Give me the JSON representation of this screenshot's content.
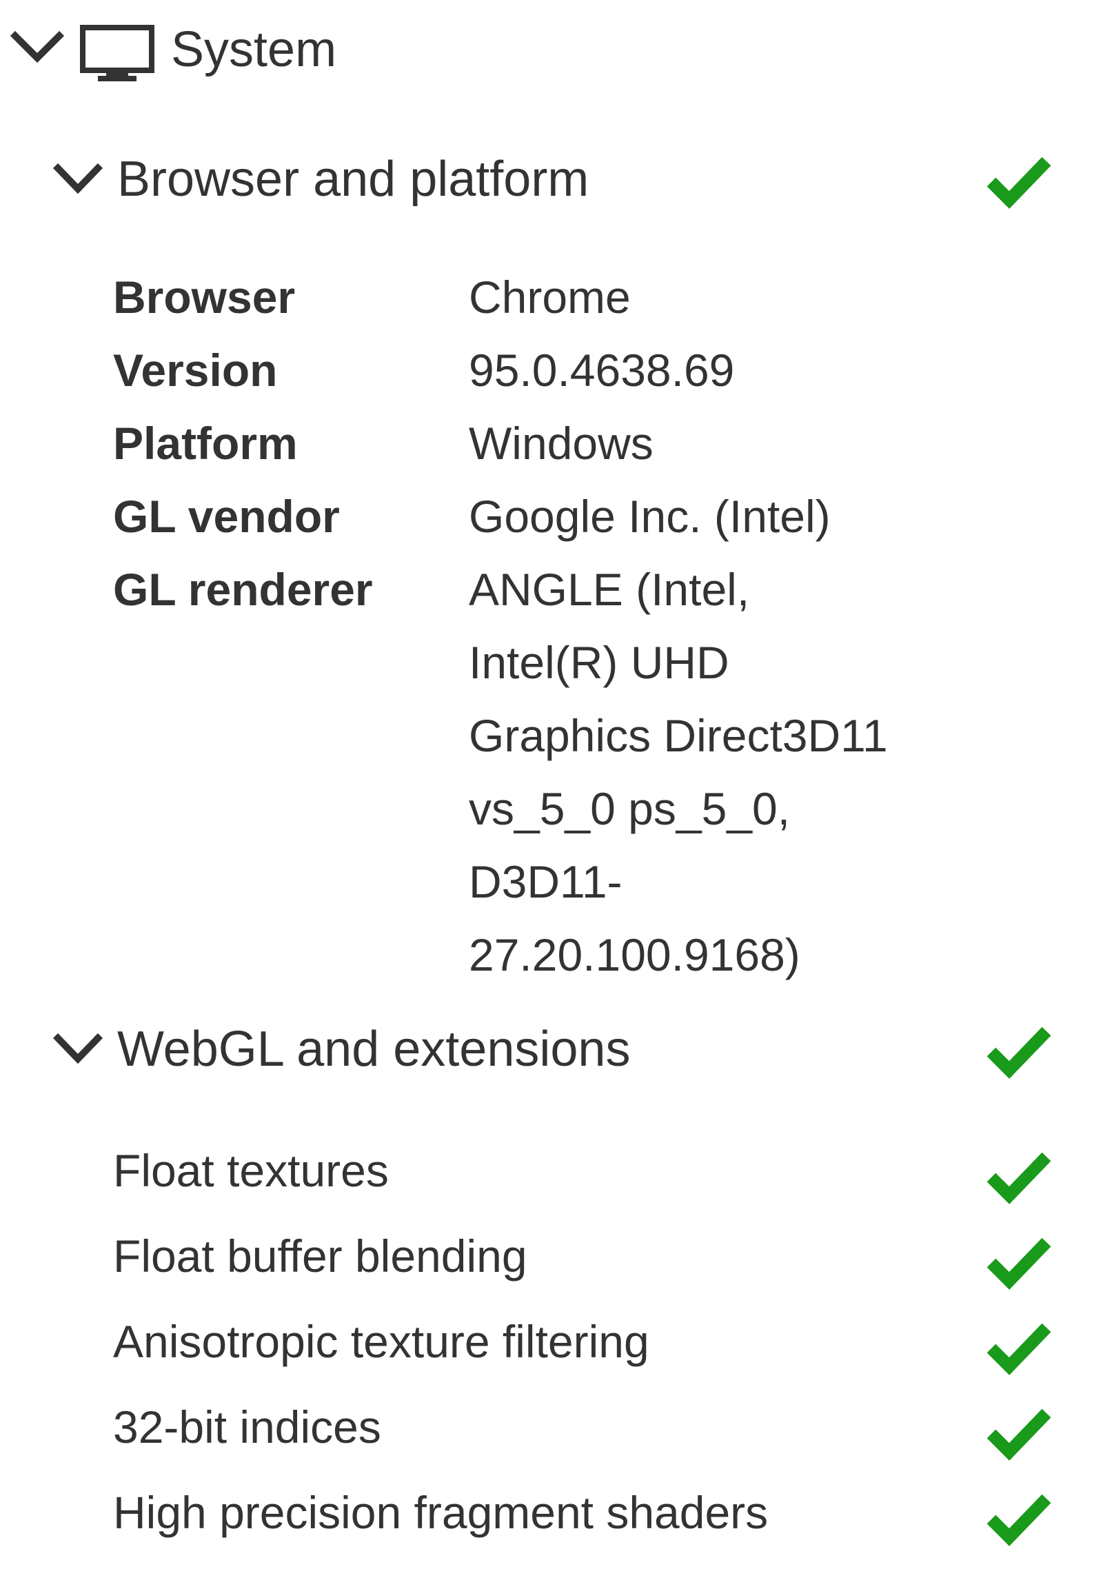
{
  "system": {
    "title": "System",
    "icon": "monitor-icon"
  },
  "browser_platform": {
    "title": "Browser and platform",
    "status": "ok",
    "rows": [
      {
        "key": "Browser",
        "value": "Chrome"
      },
      {
        "key": "Version",
        "value": "95.0.4638.69"
      },
      {
        "key": "Platform",
        "value": "Windows"
      },
      {
        "key": "GL vendor",
        "value": "Google Inc. (Intel)"
      },
      {
        "key": "GL renderer",
        "value_lines": [
          "ANGLE (Intel,",
          "Intel(R) UHD",
          "Graphics Direct3D11",
          "vs_5_0 ps_5_0,",
          "D3D11-",
          "27.20.100.9168)"
        ]
      }
    ]
  },
  "webgl": {
    "title": "WebGL and extensions",
    "status": "ok",
    "features": [
      {
        "label": "Float textures",
        "status": "ok"
      },
      {
        "label": "Float buffer blending",
        "status": "ok"
      },
      {
        "label": "Anisotropic texture filtering",
        "status": "ok"
      },
      {
        "label": "32-bit indices",
        "status": "ok"
      },
      {
        "label": "High precision fragment shaders",
        "status": "ok"
      }
    ]
  },
  "colors": {
    "text": "#333333",
    "check": "#1a9a1a"
  }
}
